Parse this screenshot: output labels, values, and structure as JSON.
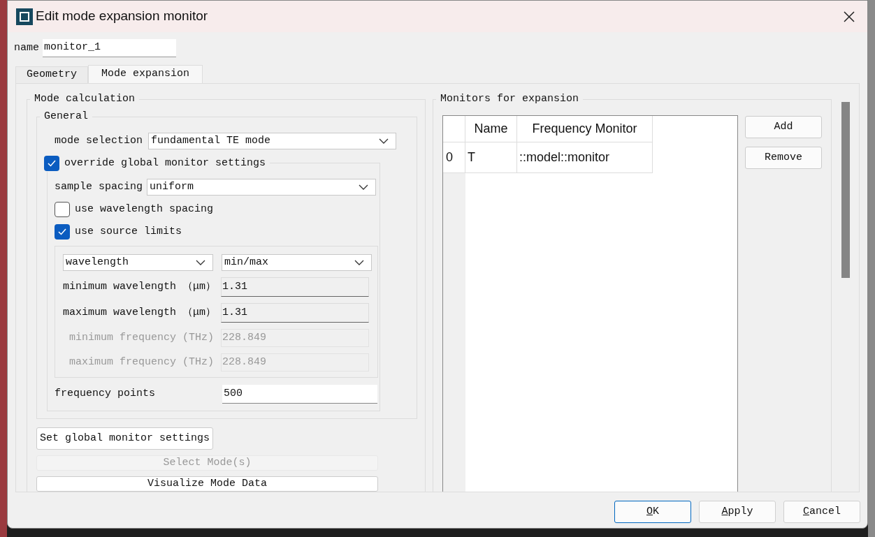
{
  "window": {
    "title": "Edit mode expansion monitor"
  },
  "name_field": {
    "label": "name",
    "value": "monitor_1"
  },
  "tabs": [
    {
      "label": "Geometry",
      "selected": false
    },
    {
      "label": "Mode expansion",
      "selected": true
    }
  ],
  "mode_calculation": {
    "title": "Mode calculation",
    "general": {
      "title": "General",
      "mode_selection": {
        "label": "mode selection",
        "value": "fundamental TE mode"
      },
      "override": {
        "label": "override global monitor settings",
        "checked": true
      },
      "sample_spacing": {
        "label": "sample spacing",
        "value": "uniform"
      },
      "options": [
        {
          "label": "use wavelength spacing",
          "checked": false
        },
        {
          "label": "use source limits",
          "checked": true
        }
      ],
      "range": {
        "type": "wavelength",
        "limits": "min/max"
      },
      "fields": [
        {
          "label": "minimum wavelength （μm）",
          "value": "1.31",
          "disabled": false
        },
        {
          "label": "maximum wavelength （μm）",
          "value": "1.31",
          "disabled": false
        },
        {
          "label": "minimum frequency (THz)",
          "value": "228.849",
          "disabled": true
        },
        {
          "label": "maximum frequency (THz)",
          "value": "228.849",
          "disabled": true
        }
      ],
      "frequency_points": {
        "label": "frequency points",
        "value": "500"
      }
    },
    "buttons": [
      {
        "label": "Set global monitor settings",
        "disabled": false,
        "kind": "compact"
      },
      {
        "label": "Select Mode(s)",
        "disabled": true,
        "kind": "wide"
      },
      {
        "label": "Visualize Mode Data",
        "disabled": false,
        "kind": "wide"
      }
    ]
  },
  "monitors": {
    "title": "Monitors for expansion",
    "columns": [
      "Name",
      "Frequency Monitor"
    ],
    "rows": [
      {
        "index": "0",
        "cells": [
          "T",
          "::model::monitor"
        ]
      }
    ],
    "buttons": [
      "Add",
      "Remove"
    ]
  },
  "dialog_buttons": [
    {
      "label": "OK",
      "default": true
    },
    {
      "label": "Apply",
      "default": false
    },
    {
      "label": "Cancel",
      "default": false
    }
  ]
}
